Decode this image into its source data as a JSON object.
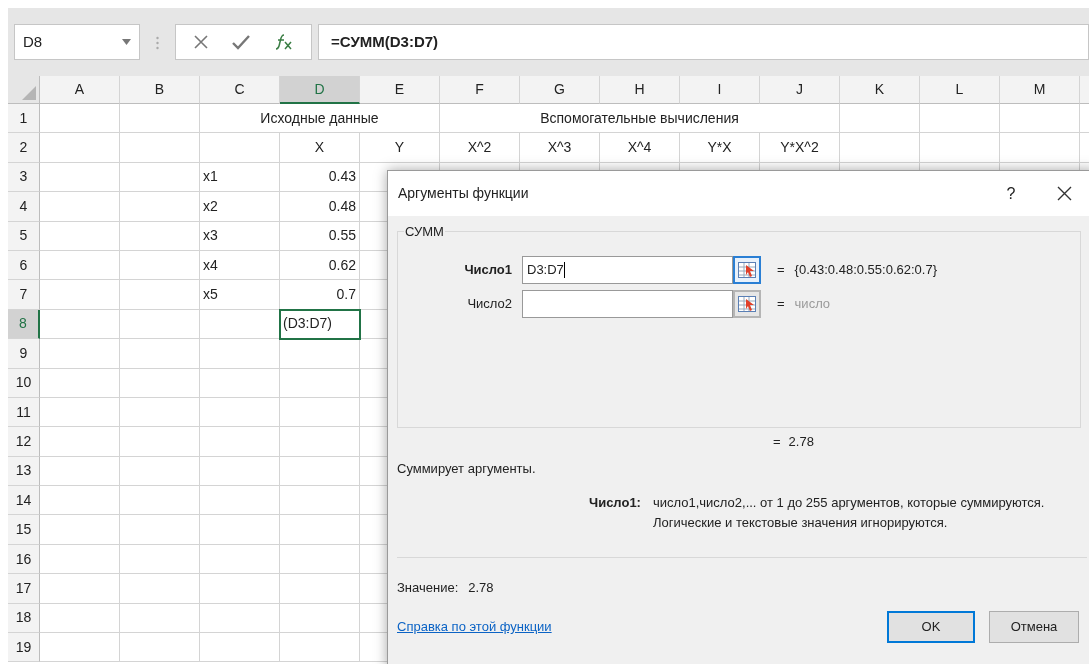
{
  "name_box": {
    "value": "D8"
  },
  "formula_bar": {
    "value": "=СУММ(D3:D7)"
  },
  "columns": [
    {
      "label": "A",
      "selected": false
    },
    {
      "label": "B",
      "selected": false
    },
    {
      "label": "C",
      "selected": false
    },
    {
      "label": "D",
      "selected": true
    },
    {
      "label": "E",
      "selected": false
    },
    {
      "label": "F",
      "selected": false
    },
    {
      "label": "G",
      "selected": false
    },
    {
      "label": "H",
      "selected": false
    },
    {
      "label": "I",
      "selected": false
    },
    {
      "label": "J",
      "selected": false
    },
    {
      "label": "K",
      "selected": false
    },
    {
      "label": "L",
      "selected": false
    },
    {
      "label": "M",
      "selected": false
    }
  ],
  "rows": [
    {
      "label": "1",
      "selected": false,
      "cells": [
        null,
        null,
        {
          "text": "Исходные данные",
          "kind": "merged"
        },
        null,
        null,
        {
          "text": "Вспомогательные вычисления",
          "kind": "merged"
        },
        null,
        null,
        null,
        null
      ]
    },
    {
      "label": "2",
      "selected": false,
      "cells": [
        null,
        null,
        null,
        {
          "text": "X",
          "kind": "header"
        },
        {
          "text": "Y",
          "kind": "header"
        },
        {
          "text": "X^2",
          "kind": "header"
        },
        {
          "text": "X^3",
          "kind": "header"
        },
        {
          "text": "X^4",
          "kind": "header"
        },
        {
          "text": "Y*X",
          "kind": "header"
        },
        {
          "text": "Y*X^2",
          "kind": "header"
        }
      ]
    },
    {
      "label": "3",
      "selected": false,
      "cells": [
        null,
        null,
        {
          "text": "x1",
          "kind": "text"
        },
        {
          "text": "0.43",
          "kind": "number"
        }
      ]
    },
    {
      "label": "4",
      "selected": false,
      "cells": [
        null,
        null,
        {
          "text": "x2",
          "kind": "text"
        },
        {
          "text": "0.48",
          "kind": "number"
        }
      ]
    },
    {
      "label": "5",
      "selected": false,
      "cells": [
        null,
        null,
        {
          "text": "x3",
          "kind": "text"
        },
        {
          "text": "0.55",
          "kind": "number"
        }
      ]
    },
    {
      "label": "6",
      "selected": false,
      "cells": [
        null,
        null,
        {
          "text": "x4",
          "kind": "text"
        },
        {
          "text": "0.62",
          "kind": "number"
        }
      ]
    },
    {
      "label": "7",
      "selected": false,
      "cells": [
        null,
        null,
        {
          "text": "x5",
          "kind": "text"
        },
        {
          "text": "0.7",
          "kind": "number"
        }
      ]
    },
    {
      "label": "8",
      "selected": true,
      "cells": [
        null,
        null,
        null,
        {
          "text": "(D3:D7)",
          "kind": "active"
        }
      ]
    },
    {
      "label": "9",
      "selected": false,
      "cells": []
    },
    {
      "label": "10",
      "selected": false,
      "cells": []
    },
    {
      "label": "11",
      "selected": false,
      "cells": []
    },
    {
      "label": "12",
      "selected": false,
      "cells": []
    },
    {
      "label": "13",
      "selected": false,
      "cells": []
    },
    {
      "label": "14",
      "selected": false,
      "cells": []
    },
    {
      "label": "15",
      "selected": false,
      "cells": []
    },
    {
      "label": "16",
      "selected": false,
      "cells": []
    },
    {
      "label": "17",
      "selected": false,
      "cells": []
    },
    {
      "label": "18",
      "selected": false,
      "cells": []
    },
    {
      "label": "19",
      "selected": false,
      "cells": []
    }
  ],
  "dialog": {
    "title": "Аргументы функции",
    "help": "?",
    "group": "СУММ",
    "arguments": [
      {
        "label": "Число1",
        "value": "D3:D7",
        "selected": true,
        "equals": "=",
        "result": "{0.43:0.48:0.55:0.62:0.7}",
        "hint": false
      },
      {
        "label": "Число2",
        "selected": false,
        "equals": "=",
        "result": "число",
        "hint": true
      }
    ],
    "total": {
      "equals": "=",
      "value": "2.78"
    },
    "description": "Суммирует аргументы.",
    "argument_help": {
      "label": "Число1:",
      "lines": [
        "число1,число2,... от 1 до 255 аргументов, которые суммируются.",
        "Логические и текстовые значения игнорируются."
      ]
    },
    "value_label": "Значение:",
    "value": "2.78",
    "help_link": "Справка по этой функции",
    "buttons": [
      {
        "label": "OK",
        "selected": true
      },
      {
        "label": "Отмена",
        "selected": false
      }
    ]
  }
}
